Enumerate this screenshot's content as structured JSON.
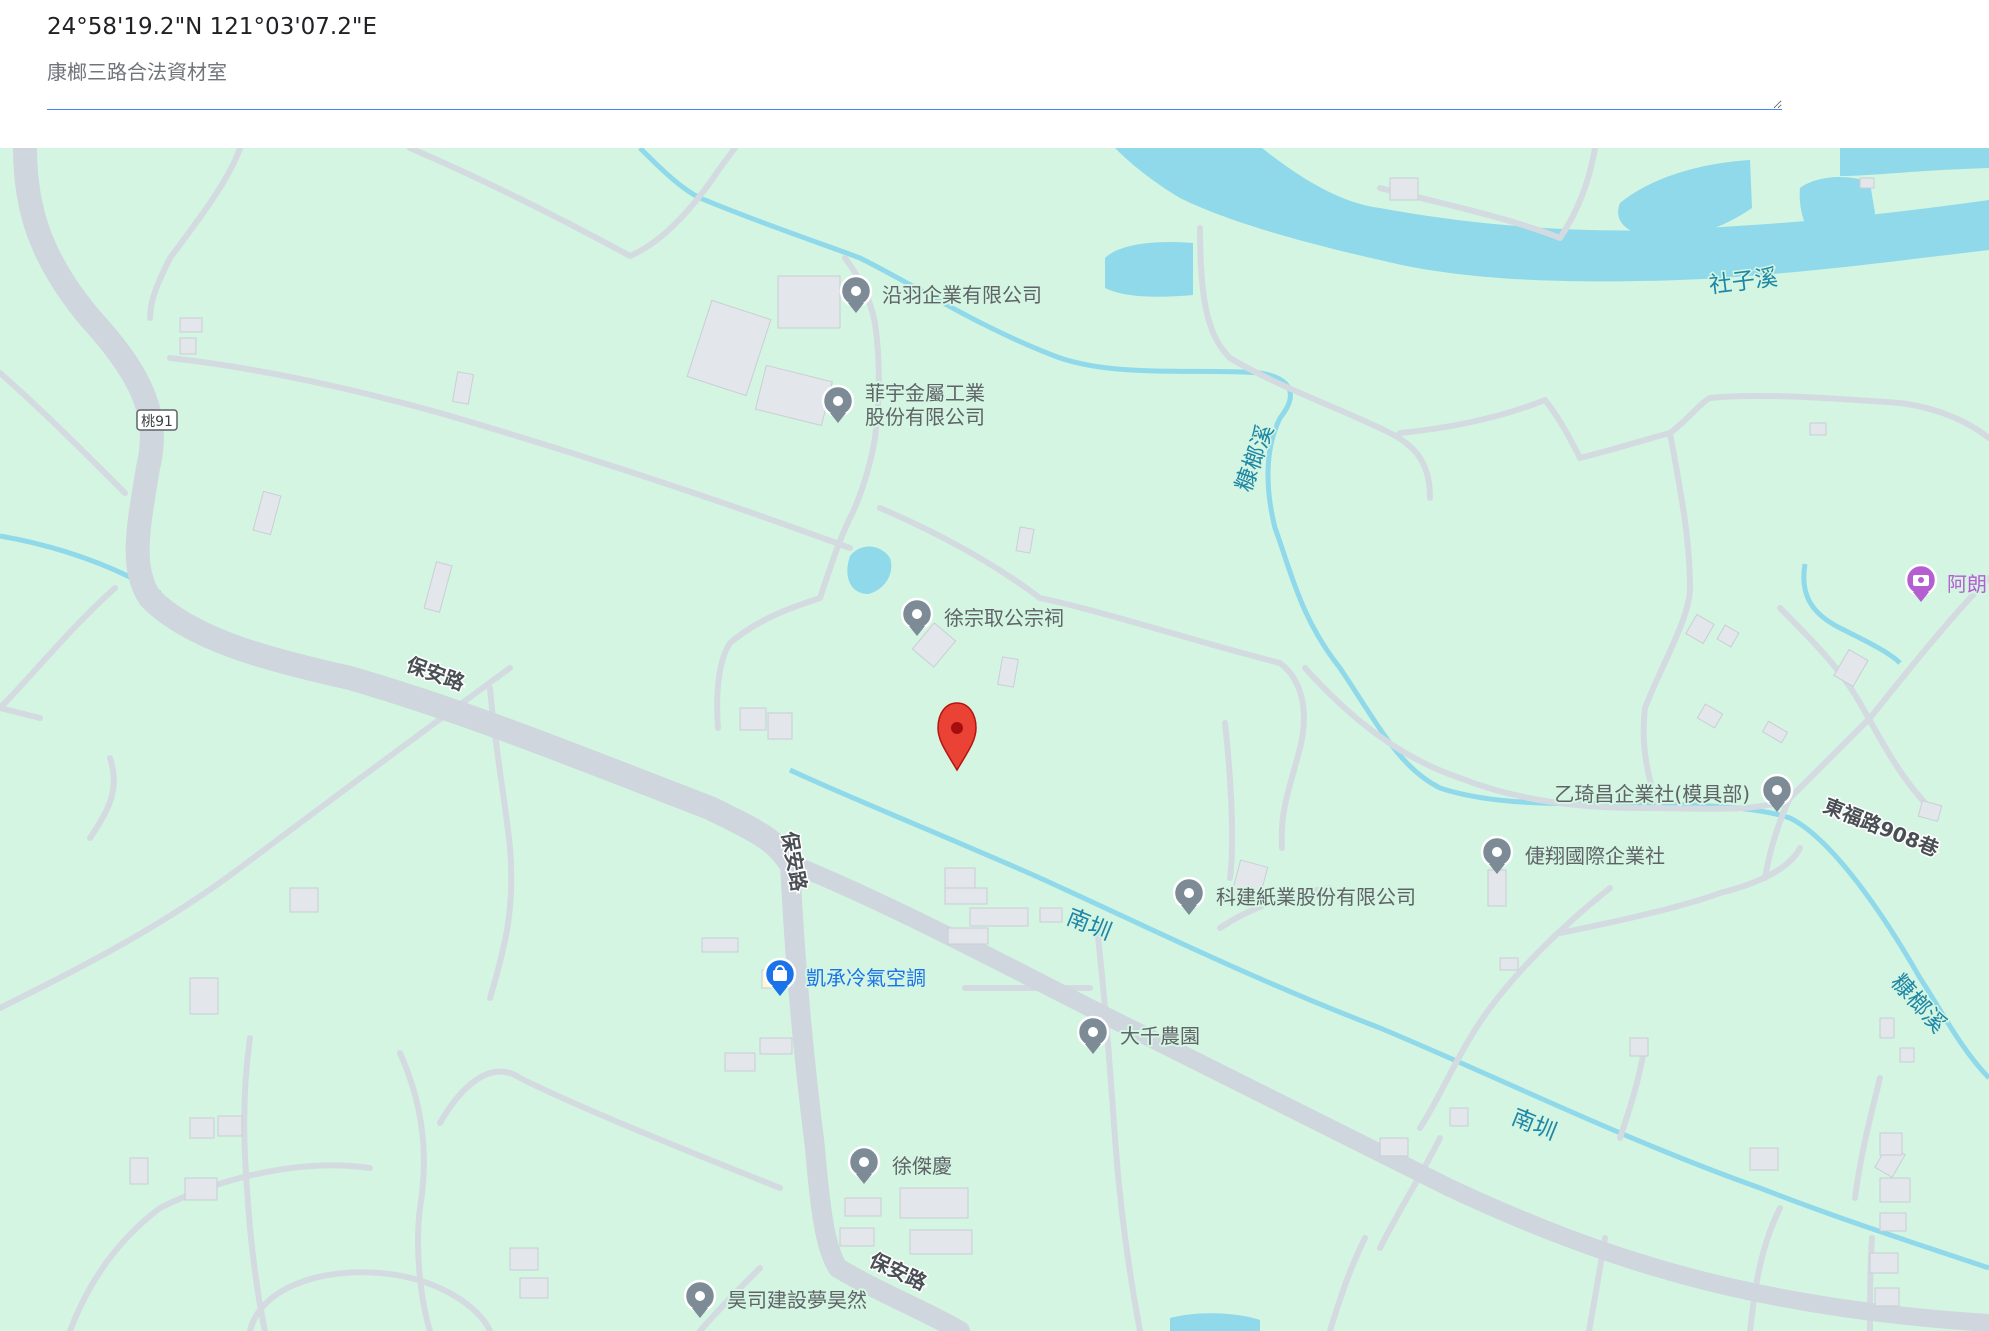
{
  "header": {
    "coordinates": "24°58'19.2\"N 121°03'07.2\"E",
    "note_value": "康榔三路合法資材室"
  },
  "map": {
    "colors": {
      "land": "#d4f5e2",
      "water": "#8fd9ea",
      "road": "#d3dbe1",
      "marker": "#ea4335",
      "poi_grey": "#7c8b95",
      "poi_blue": "#1a73e8",
      "poi_purple": "#b55ed1"
    },
    "roads": {
      "baoan_1": "保安路",
      "baoan_2": "保安路",
      "baoan_3": "保安路",
      "dongfu": "東福路908巷",
      "route": "桃91"
    },
    "water": {
      "shezi": "社子溪",
      "kangliu_1": "糠榔溪",
      "kangliu_2": "糠榔溪",
      "nanzun_1": "南圳",
      "nanzun_2": "南圳"
    },
    "pois": {
      "yanyu": "沿羽企業有限公司",
      "feiyu_1": "菲宇金屬工業",
      "feiyu_2": "股份有限公司",
      "xuzong": "徐宗取公宗祠",
      "yiqi": "乙琦昌企業社(模具部)",
      "shixiang": "倢翔國際企業社",
      "kejian": "科建紙業股份有限公司",
      "kaicheng": "凱承冷氣空調",
      "daqian": "大千農園",
      "xujie": "徐傑慶",
      "haosi": "昊司建設夢昊然",
      "alang": "阿朗"
    }
  }
}
